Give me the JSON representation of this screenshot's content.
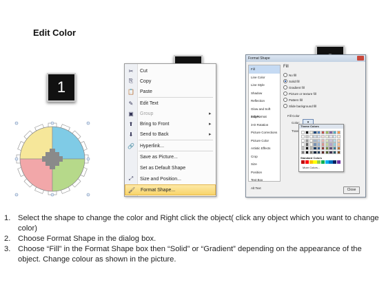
{
  "title": "Edit Color",
  "badges": [
    "1",
    "2",
    "3"
  ],
  "context_menu": {
    "items": [
      {
        "icon": "✂",
        "label": "Cut",
        "disabled": false,
        "submenu": false
      },
      {
        "icon": "⎘",
        "label": "Copy",
        "disabled": false,
        "submenu": false
      },
      {
        "icon": "📋",
        "label": "Paste",
        "disabled": false,
        "submenu": false
      },
      {
        "icon": "✎",
        "label": "Edit Text",
        "disabled": false,
        "submenu": false
      },
      {
        "icon": "▣",
        "label": "Group",
        "disabled": true,
        "submenu": true
      },
      {
        "icon": "⬆",
        "label": "Bring to Front",
        "disabled": false,
        "submenu": true
      },
      {
        "icon": "⬇",
        "label": "Send to Back",
        "disabled": false,
        "submenu": true
      },
      {
        "icon": "🔗",
        "label": "Hyperlink...",
        "disabled": false,
        "submenu": false
      },
      {
        "icon": "",
        "label": "Save as Picture...",
        "disabled": false,
        "submenu": false
      },
      {
        "icon": "",
        "label": "Set as Default Shape",
        "disabled": false,
        "submenu": false
      },
      {
        "icon": "⤢",
        "label": "Size and Position...",
        "disabled": false,
        "submenu": false
      },
      {
        "icon": "🖌",
        "label": "Format Shape...",
        "disabled": false,
        "submenu": false,
        "highlighted": true
      }
    ]
  },
  "dialog": {
    "title": "Format Shape",
    "categories": [
      "Fill",
      "Line Color",
      "Line Style",
      "Shadow",
      "Reflection",
      "Glow and Soft Edges",
      "3-D Format",
      "3-D Rotation",
      "Picture Corrections",
      "Picture Color",
      "Artistic Effects",
      "Crop",
      "Size",
      "Position",
      "Text Box",
      "Alt Text"
    ],
    "selected_category": "Fill",
    "pane_title": "Fill",
    "options": [
      "No fill",
      "Solid fill",
      "Gradient fill",
      "Picture or texture fill",
      "Pattern fill",
      "Slide background fill"
    ],
    "selected_option": "Solid fill",
    "fill_color_label": "Fill Color",
    "color_label": "Color:",
    "transparency_label": "Transpa",
    "close_label": "Close"
  },
  "palette": {
    "theme_label": "Theme Colors",
    "standard_label": "Standard Colors",
    "more_label": "More Colors...",
    "theme_top": [
      "#ffffff",
      "#000000",
      "#eeece1",
      "#1f497d",
      "#4f81bd",
      "#c0504d",
      "#9bbb59",
      "#8064a2",
      "#4bacc6",
      "#f79646"
    ],
    "standard": [
      "#c00000",
      "#ff0000",
      "#ffc000",
      "#ffff00",
      "#92d050",
      "#00b050",
      "#00b0f0",
      "#0070c0",
      "#002060",
      "#7030a0"
    ]
  },
  "gear_colors": {
    "yellow": "#f6e79a",
    "blue": "#7fcbe6",
    "pink": "#f2a7a9",
    "green": "#b6d98a",
    "center": "#8a8a8a"
  },
  "instructions": [
    {
      "num": "1.",
      "text": "Select the shape to change the color and Right click the object( click any object which you want to change color)"
    },
    {
      "num": "2.",
      "text": "Choose Format Shape in the dialog box."
    },
    {
      "num": "3.",
      "text": "Choose “Fill” in the Format Shape box then “Solid” or “Gradient” depending on the appearance of the object. Change colour as shown in the picture."
    }
  ]
}
